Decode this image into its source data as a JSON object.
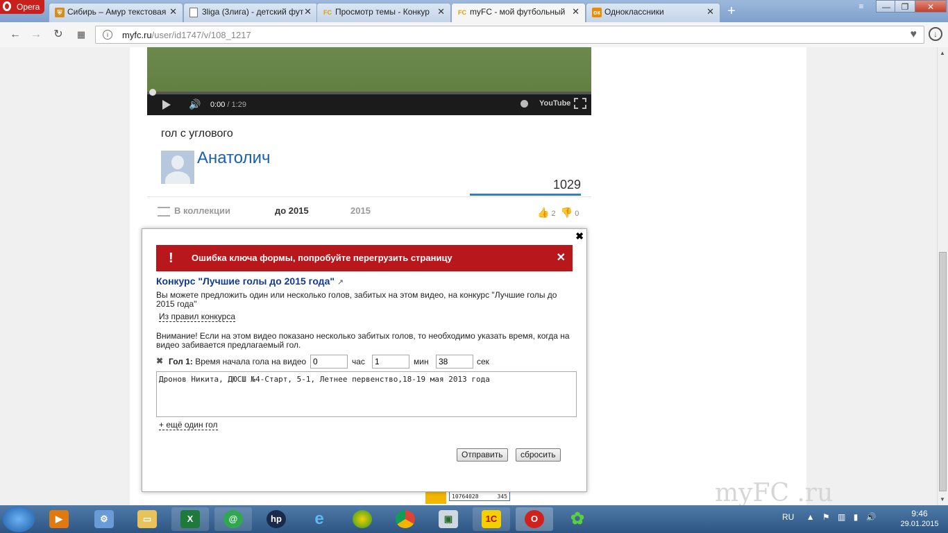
{
  "browser": {
    "menu_label": "Opera",
    "tabs": [
      {
        "title": "Сибирь – Амур текстовая",
        "icon": "shield-icon"
      },
      {
        "title": "3liga (3лига) - детский фут",
        "icon": "page-icon"
      },
      {
        "title": "Просмотр темы - Конкур",
        "icon": "FC"
      },
      {
        "title": "myFC - мой футбольный",
        "icon": "FC"
      },
      {
        "title": "Одноклассники",
        "icon": "ok-icon"
      }
    ],
    "url_host": "myfc.ru",
    "url_path": "/user/id1747/v/108_1217"
  },
  "video": {
    "time_current": "0:00",
    "time_total": " / 1:29",
    "youtube_label": "YouTube",
    "progress": 0
  },
  "post": {
    "title": "гол с углового",
    "author": "Анатолич",
    "views": "1029",
    "tab_collection": "В коллекции",
    "tab_before2015": "до 2015",
    "tab_2015": "2015",
    "likes": "2",
    "dislikes": "0"
  },
  "modal": {
    "error": "Ошибка ключа формы, попробуйте перегрузить страницу",
    "contest_title": "Конкурс \"Лучшие голы до 2015 года\"",
    "contest_desc": "Вы можете предложить один или несколько голов, забитых на этом видео, на конкурс \"Лучшие голы до 2015 года\"",
    "rules_link": "Из правил конкурса",
    "warning": "Внимание! Если на этом видео показано несколько забитых голов, то необходимо указать время, когда на видео забивается предлагаемый гол.",
    "goal_label_bold": "Гол 1:",
    "goal_label": "Время начала гола на видео",
    "hours": "0",
    "hours_unit": "час",
    "minutes": "1",
    "minutes_unit": "мин",
    "seconds": "38",
    "seconds_unit": "сек",
    "description": "Дронов Никита, ДЮСШ №4-Старт, 5-1, Летнее первенство,18-19 мая 2013 года",
    "add_goal": "+ ещё один гол",
    "submit": "Отправить",
    "reset": "сбросить"
  },
  "footer": {
    "counter_value": "10764028",
    "counter_small": "345",
    "watermark": "myFC .ru"
  },
  "taskbar": {
    "lang": "RU",
    "time": "9:46",
    "date": "29.01.2015"
  },
  "colors": {
    "error_bg": "#b8171c",
    "link_blue": "#1a5fb4",
    "contest_title": "#123a8c",
    "views_underline": "#2e7fc8"
  }
}
